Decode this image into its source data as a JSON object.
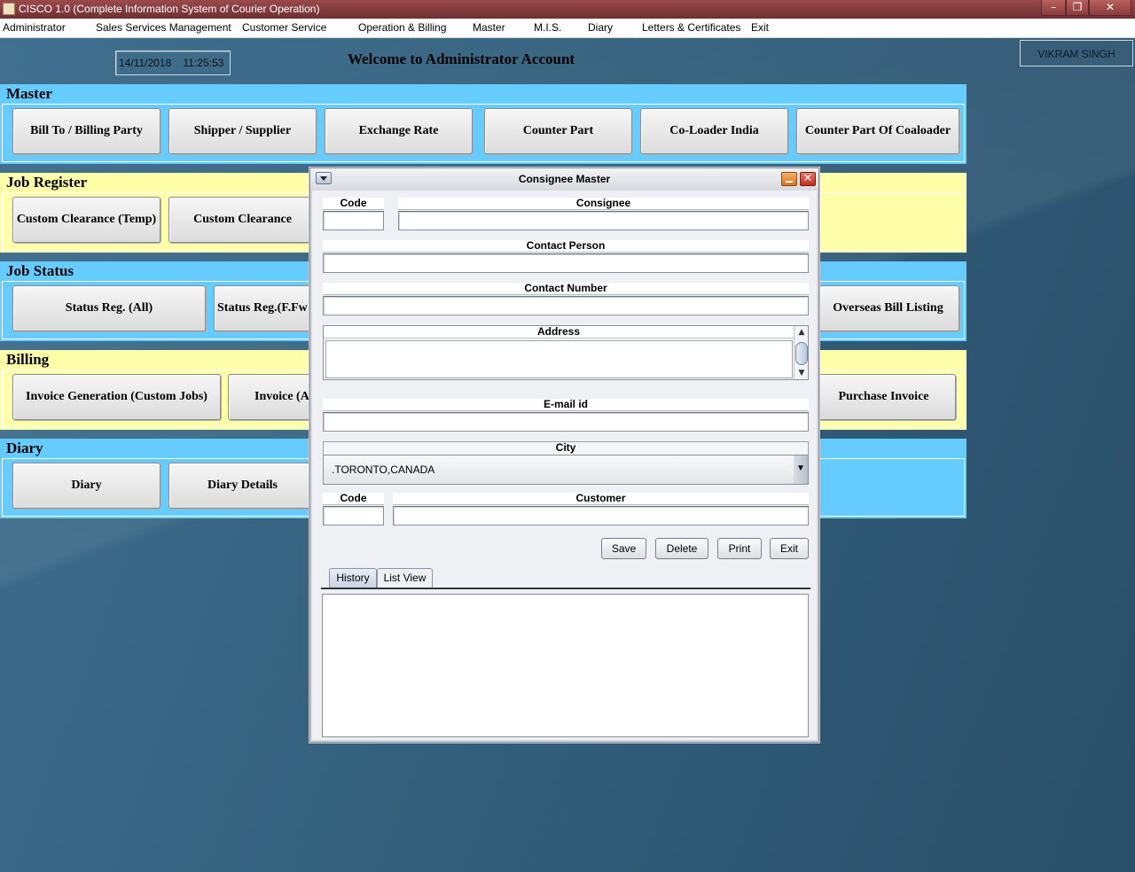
{
  "window": {
    "title": "CISCO 1.0 (Complete Information System of Courier Operation)",
    "controls": [
      "minimize-icon",
      "restore-icon",
      "close-icon"
    ]
  },
  "menubar": {
    "items": [
      "Administrator",
      "Sales Services Management",
      "Customer Service",
      "Operation & Billing",
      "Master",
      "M.I.S.",
      "Diary",
      "Letters & Certificates",
      "Exit"
    ]
  },
  "header": {
    "date": "14/11/2018",
    "time": "11:25:53",
    "welcome": "Welcome to Administrator Account",
    "user": "VIKRAM SINGH"
  },
  "sections": {
    "master": {
      "title": "Master",
      "buttons": [
        "Bill To / Billing Party",
        "Shipper / Supplier",
        "Exchange Rate",
        "Counter Part",
        "Co-Loader India",
        "Counter Part Of Coaloader"
      ]
    },
    "job_register": {
      "title": "Job Register",
      "buttons": [
        "Custom Clearance (Temp)",
        "Custom Clearance"
      ]
    },
    "job_status": {
      "title": "Job Status",
      "buttons": [
        "Status Reg. (All)",
        "Status Reg.(F.Fw",
        "Overseas Bill Listing"
      ]
    },
    "billing": {
      "title": "Billing",
      "buttons": [
        "Invoice Generation (Custom Jobs)",
        "Invoice (A",
        "Purchase Invoice"
      ]
    },
    "diary": {
      "title": "Diary",
      "buttons": [
        "Diary",
        "Diary Details"
      ]
    }
  },
  "dialog": {
    "title": "Consignee Master",
    "labels": {
      "code": "Code",
      "consignee": "Consignee",
      "contact_person": "Contact Person",
      "contact_number": "Contact Number",
      "address": "Address",
      "email": "E-mail id",
      "city": "City",
      "code2": "Code",
      "customer": "Customer"
    },
    "fields": {
      "code": "",
      "consignee": "",
      "contact_person": "",
      "contact_number": "",
      "address": "",
      "email": "",
      "city": ".TORONTO,CANADA",
      "code2": "",
      "customer": ""
    },
    "buttons": {
      "save": "Save",
      "delete": "Delete",
      "print": "Print",
      "exit": "Exit"
    },
    "tabs": [
      "History",
      "List View"
    ],
    "active_tab": "History"
  },
  "colors": {
    "section_blue": "#66ccff",
    "section_yellow": "#ffffaa",
    "titlebar": "#8a3a3a"
  }
}
